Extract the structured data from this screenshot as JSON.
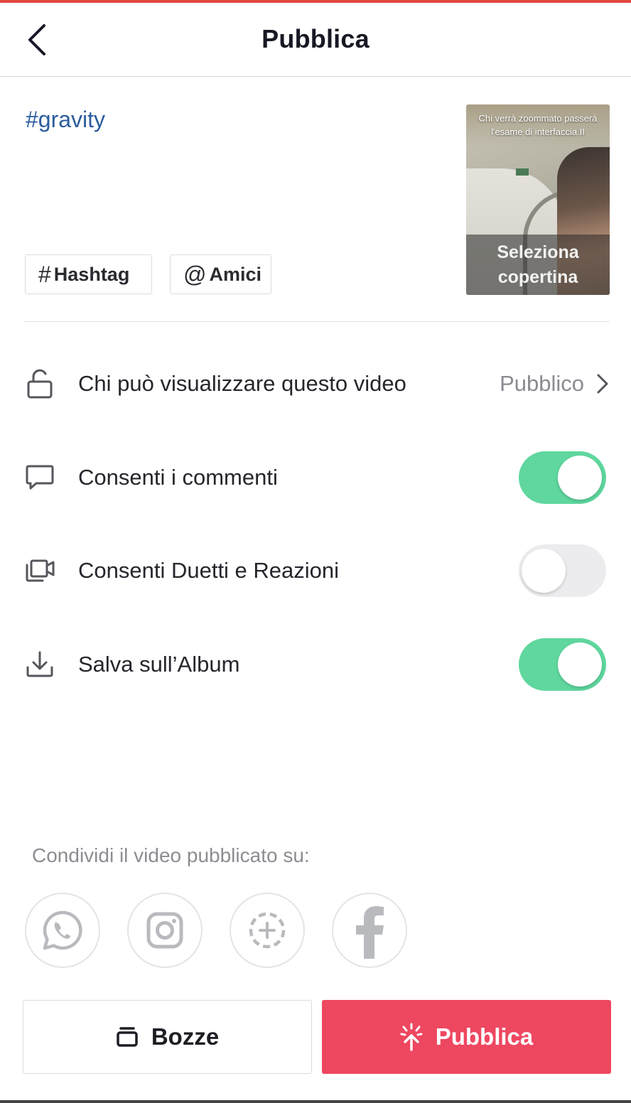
{
  "header": {
    "title": "Pubblica",
    "back_icon": "chevron-left-icon"
  },
  "post": {
    "caption": "#gravity",
    "chips": {
      "hashtag_symbol": "#",
      "hashtag_label": "Hashtag",
      "mention_symbol": "@",
      "mention_label": "Amici"
    },
    "cover": {
      "overlay_text": "Chi verrà zoommato passerà l'esame di interfaccia II",
      "select_label": "Seleziona copertina"
    }
  },
  "settings": {
    "privacy": {
      "label": "Chi può visualizzare questo video",
      "value": "Pubblico",
      "icon": "lock-open-icon"
    },
    "comments": {
      "label": "Consenti i commenti",
      "enabled": true,
      "icon": "comment-icon"
    },
    "duets": {
      "label": "Consenti Duetti e Reazioni",
      "enabled": false,
      "icon": "duet-camera-icon"
    },
    "album": {
      "label": "Salva sull’Album",
      "enabled": true,
      "icon": "download-icon"
    }
  },
  "share": {
    "label": "Condividi il video pubblicato su:",
    "targets": [
      "whatsapp-icon",
      "instagram-icon",
      "story-add-icon",
      "facebook-icon"
    ]
  },
  "actions": {
    "drafts_label": "Bozze",
    "publish_label": "Pubblica"
  },
  "colors": {
    "accent_top": "#e04a3f",
    "toggle_on": "#5fd79e",
    "publish_button": "#ee4760",
    "caption_link": "#2b5c9e"
  }
}
